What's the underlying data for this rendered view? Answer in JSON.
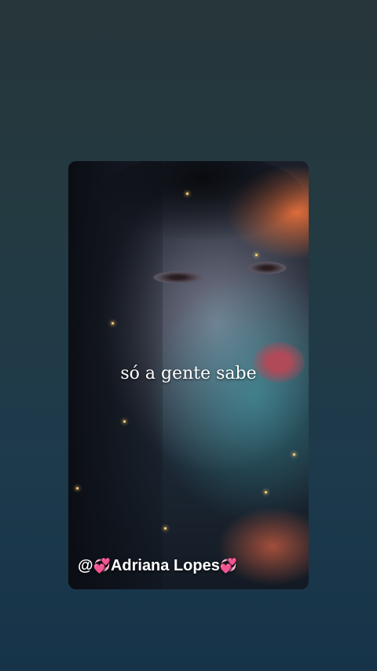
{
  "video": {
    "caption": "só a gente sabe",
    "watermark": {
      "prefix": "@",
      "heart_left": "💞",
      "name": "Adriana Lopes",
      "heart_right": "💞"
    }
  },
  "colors": {
    "background_top": "#26363a",
    "background_bottom": "#163349",
    "caption_text": "#ffffff"
  }
}
